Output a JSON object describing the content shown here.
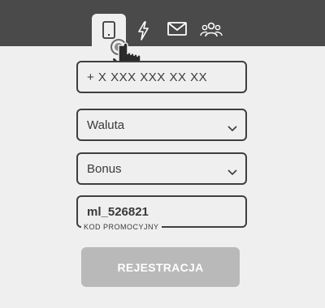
{
  "tabs": [
    {
      "icon": "phone-icon",
      "active": true
    },
    {
      "icon": "lightning-icon",
      "active": false
    },
    {
      "icon": "mail-icon",
      "active": false
    },
    {
      "icon": "users-icon",
      "active": false
    }
  ],
  "form": {
    "phone_placeholder": "+ X XXX XXX XX XX",
    "currency_value": "Waluta",
    "bonus_value": "Bonus",
    "promo_value": "ml_526821",
    "promo_label": "KOD PROMOCYJNY",
    "submit_label": "REJESTRACJA"
  },
  "colors": {
    "topbar": "#4a4a4a",
    "background": "#efefef",
    "button_disabled": "#b9b9b9"
  }
}
